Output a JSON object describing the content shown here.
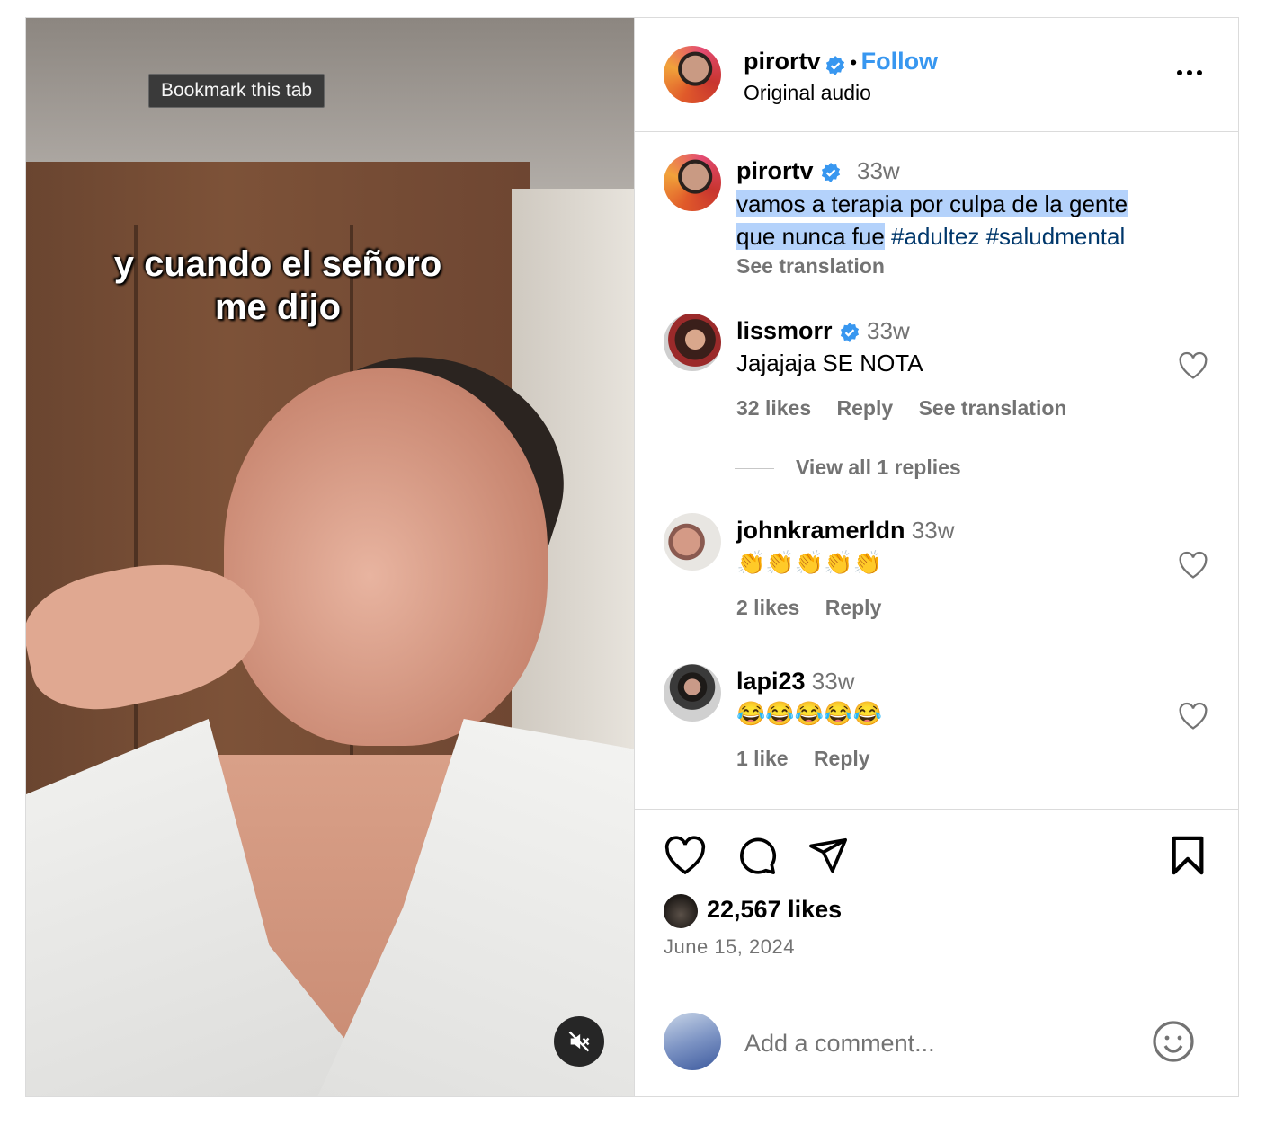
{
  "video": {
    "tooltip": "Bookmark this tab",
    "caption_line1": "y cuando el señoro",
    "caption_line2": "me dijo",
    "mute_icon": "speaker-muted-icon"
  },
  "header": {
    "username": "pirortv",
    "separator": "•",
    "follow_label": "Follow",
    "audio": "Original audio"
  },
  "post_caption": {
    "username": "pirortv",
    "time": "33w",
    "text_highlighted_1": "vamos a terapia por culpa de la gente",
    "text_highlighted_2": "que nunca fue",
    "hashtag1": "#adultez",
    "hashtag2": "#saludmental",
    "see_translation": "See translation"
  },
  "comments": [
    {
      "username": "lissmorr",
      "verified": true,
      "time": "33w",
      "text": "Jajajaja SE NOTA",
      "likes": "32 likes",
      "reply": "Reply",
      "translate": "See translation",
      "view_replies": "View all 1 replies"
    },
    {
      "username": "johnkramerldn",
      "time": "33w",
      "text": "👏👏👏👏👏",
      "likes": "2 likes",
      "reply": "Reply"
    },
    {
      "username": "lapi23",
      "time": "33w",
      "text": "😂😂😂😂😂",
      "likes": "1 like",
      "reply": "Reply"
    }
  ],
  "footer": {
    "likes": "22,567 likes",
    "date": "June 15, 2024",
    "comment_placeholder": "Add a comment..."
  },
  "colors": {
    "accent": "#3897f0",
    "highlight": "#b4d2fb",
    "hashtag": "#00376b",
    "muted": "#737373"
  }
}
